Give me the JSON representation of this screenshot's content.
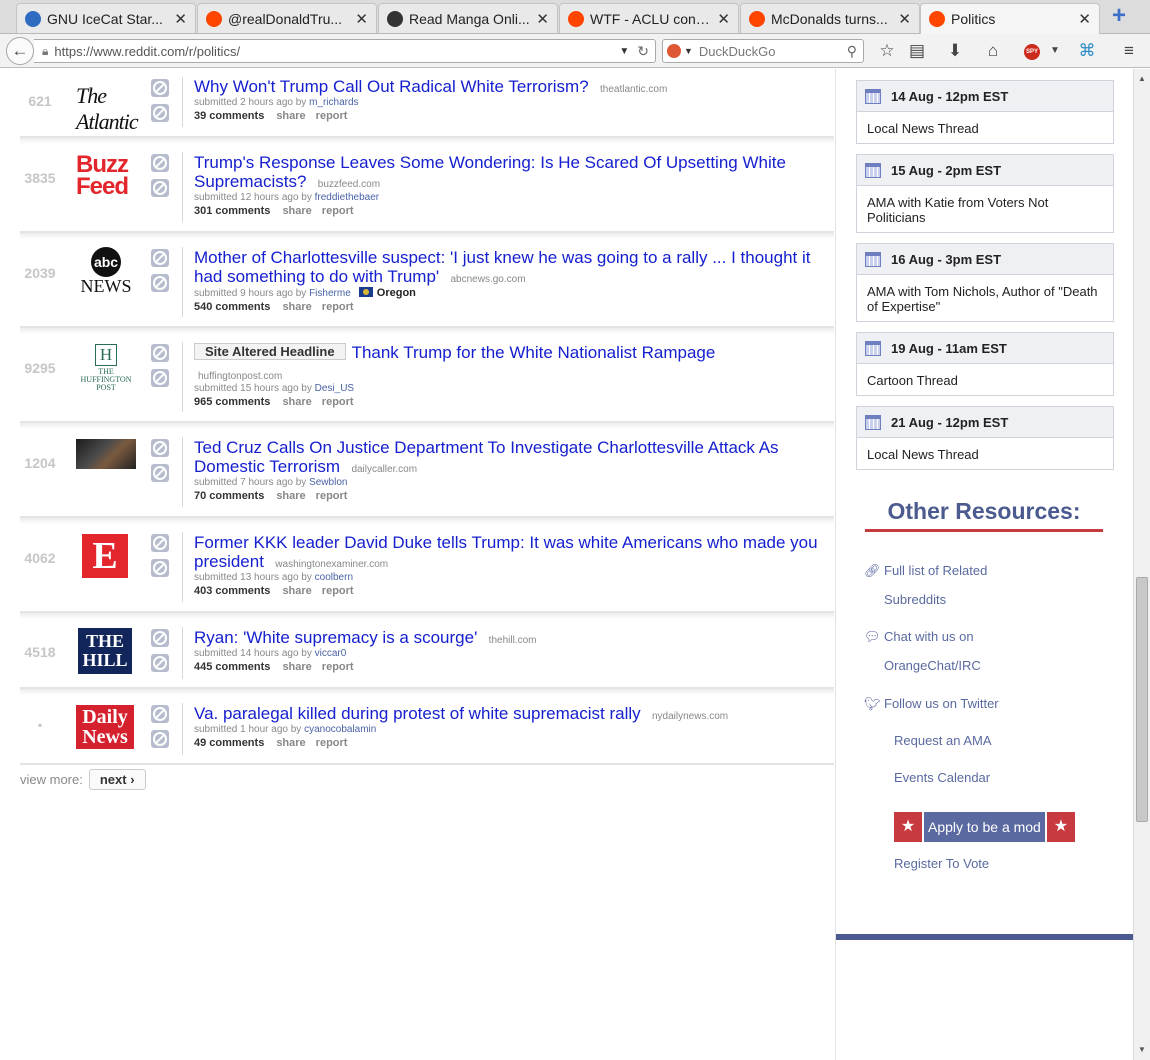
{
  "browser": {
    "tabs": [
      {
        "label": "GNU IceCat Star...",
        "color": "#2f6cc1"
      },
      {
        "label": "@realDonaldTru...",
        "color": "#ff4500"
      },
      {
        "label": "Read Manga Onli...",
        "color": "#333333"
      },
      {
        "label": "WTF - ACLU confi...",
        "color": "#ff4500"
      },
      {
        "label": "McDonalds turns...",
        "color": "#ff4500"
      },
      {
        "label": "Politics",
        "color": "#ff4500"
      }
    ],
    "url": "https://www.reddit.com/r/politics/",
    "search_placeholder": "DuckDuckGo"
  },
  "posts": [
    {
      "rank": "621",
      "logo": "atlantic",
      "title": "Why Won't Trump Call Out Radical White Terrorism?",
      "domain": "theatlantic.com",
      "time": "submitted 2 hours ago by",
      "author": "m_richards",
      "comments": "39 comments"
    },
    {
      "rank": "3835",
      "logo": "buzzfeed",
      "title": "Trump's Response Leaves Some Wondering: Is He Scared Of Upsetting White Supremacists?",
      "domain": "buzzfeed.com",
      "time": "submitted 12 hours ago by",
      "author": "freddiethebaer",
      "comments": "301 comments"
    },
    {
      "rank": "2039",
      "logo": "abc",
      "title": "Mother of Charlottesville suspect: 'I just knew he was going to a rally ... I thought it had something to do with Trump'",
      "domain": "abcnews.go.com",
      "time": "submitted 9 hours ago by",
      "author": "Fisherme",
      "flair": "Oregon",
      "comments": "540 comments"
    },
    {
      "rank": "9295",
      "logo": "huffpost",
      "altered": "Site Altered Headline",
      "title": "Thank Trump for the White Nationalist Rampage",
      "domain": "huffingtonpost.com",
      "time": "submitted 15 hours ago by",
      "author": "Desi_US",
      "comments": "965 comments"
    },
    {
      "rank": "1204",
      "logo": "photo",
      "title": "Ted Cruz Calls On Justice Department To Investigate Charlottesville Attack As Domestic Terrorism",
      "domain": "dailycaller.com",
      "time": "submitted 7 hours ago by",
      "author": "Sewblon",
      "comments": "70 comments"
    },
    {
      "rank": "4062",
      "logo": "examiner",
      "title": "Former KKK leader David Duke tells Trump: It was white Americans who made you president",
      "domain": "washingtonexaminer.com",
      "time": "submitted 13 hours ago by",
      "author": "coolbern",
      "comments": "403 comments"
    },
    {
      "rank": "4518",
      "logo": "hill",
      "title": "Ryan: 'White supremacy is a scourge'",
      "domain": "thehill.com",
      "time": "submitted 14 hours ago by",
      "author": "viccar0",
      "comments": "445 comments"
    },
    {
      "rank": "•",
      "logo": "dailynews",
      "title": "Va. paralegal killed during protest of white supremacist rally",
      "domain": "nydailynews.com",
      "time": "submitted 1 hour ago by",
      "author": "cyanocobalamin",
      "comments": "49 comments"
    }
  ],
  "post_actions": {
    "share": "share",
    "report": "report"
  },
  "logos": {
    "atlantic": "The Atlantic",
    "buzz": "Buzz",
    "feed": "Feed",
    "abc": "abc",
    "news": "NEWS",
    "huff_h": "H",
    "huff_name": "THE HUFFINGTON POST",
    "examiner": "E",
    "the": "THE",
    "hill": "HILL",
    "daily": "Daily",
    "dnews": "News"
  },
  "view_more": {
    "label": "view more:",
    "next": "next ›"
  },
  "events": [
    {
      "date": "14 Aug - 12pm EST",
      "title": "Local News Thread"
    },
    {
      "date": "15 Aug - 2pm EST",
      "title": "AMA with Katie from Voters Not Politicians"
    },
    {
      "date": "16 Aug - 3pm EST",
      "title": "AMA with Tom Nichols, Author of \"Death of Expertise\""
    },
    {
      "date": "19 Aug - 11am EST",
      "title": "Cartoon Thread"
    },
    {
      "date": "21 Aug - 12pm EST",
      "title": "Local News Thread"
    }
  ],
  "resources": {
    "heading": "Other Resources:",
    "links": [
      {
        "line1": "Full list of Related",
        "line2": "Subreddits",
        "icon": "link-icon"
      },
      {
        "line1": "Chat with us on",
        "line2": "OrangeChat/IRC",
        "icon": "chat-icon"
      },
      {
        "line1": "Follow us on Twitter",
        "icon": "twitter-icon"
      },
      {
        "line1": "Request an AMA"
      },
      {
        "line1": "Events Calendar"
      }
    ],
    "apply": "Apply to be a mod",
    "register": "Register To Vote"
  },
  "colors": {
    "link": "#1620cf",
    "accent_red": "#c73a3f",
    "accent_blue": "#4c5b8f"
  }
}
